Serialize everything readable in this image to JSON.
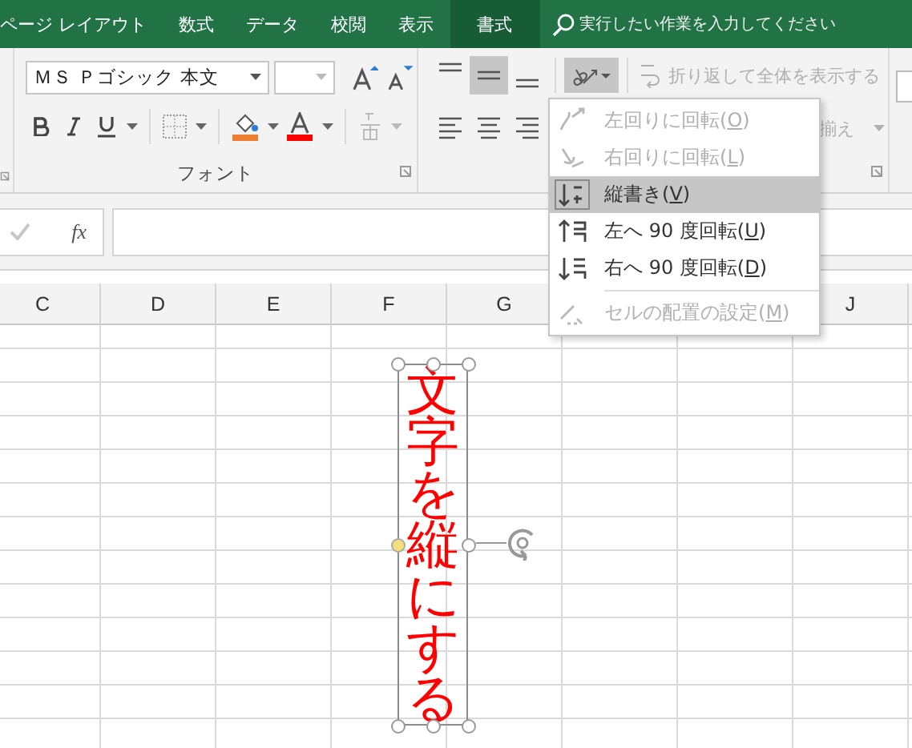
{
  "tabs": [
    {
      "label": "ページ レイアウト",
      "selected": false
    },
    {
      "label": "数式",
      "selected": false
    },
    {
      "label": "データ",
      "selected": false
    },
    {
      "label": "校閲",
      "selected": false
    },
    {
      "label": "表示",
      "selected": false
    },
    {
      "label": "書式",
      "selected": true
    }
  ],
  "tell_me": {
    "placeholder": "実行したい作業を入力してください"
  },
  "font_group": {
    "font_name": "ＭＳ Ｐゴシック 本文",
    "label": "フォント",
    "phonetic_disabled": true
  },
  "alignment_group": {
    "vertical": [
      {
        "kind": "top",
        "selected": false
      },
      {
        "kind": "middle",
        "selected": true
      },
      {
        "kind": "bottom",
        "selected": false
      }
    ],
    "horizontal": [
      {
        "kind": "left",
        "selected": false
      },
      {
        "kind": "center",
        "selected": false
      },
      {
        "kind": "right",
        "selected": false
      }
    ],
    "orientation_open": true,
    "wrap_text": {
      "label": "折り返して全体を表示する",
      "disabled": true
    },
    "merge": {
      "label": "揃え",
      "disabled": true
    }
  },
  "orientation_menu": [
    {
      "kind": "ccw",
      "label": "左回りに回転(O)",
      "disabled": true,
      "selected": false
    },
    {
      "kind": "cw",
      "label": "右回りに回転(L)",
      "disabled": true,
      "selected": false
    },
    {
      "kind": "vertical",
      "label": "縦書き(V)",
      "disabled": false,
      "selected": true
    },
    {
      "kind": "up",
      "label": "左へ 90 度回転(U)",
      "disabled": false,
      "selected": false
    },
    {
      "kind": "down",
      "label": "右へ 90 度回転(D)",
      "disabled": false,
      "selected": false
    },
    {
      "kind": "format",
      "label": "セルの配置の設定(M)",
      "disabled": true,
      "selected": false
    }
  ],
  "formula_bar": {
    "fx": "fx",
    "enter_disabled": true
  },
  "columns": [
    {
      "label": "C"
    },
    {
      "label": "D"
    },
    {
      "label": "E"
    },
    {
      "label": "F"
    },
    {
      "label": "G"
    },
    {
      "label": "J"
    }
  ],
  "shape": {
    "text": "文字を縦にする",
    "selected": true
  }
}
